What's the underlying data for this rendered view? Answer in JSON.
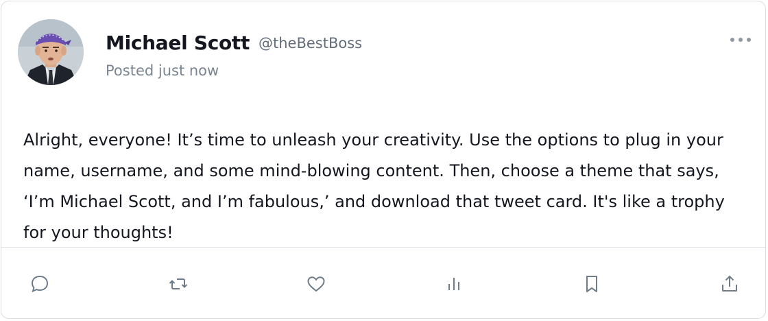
{
  "post": {
    "author": {
      "name": "Michael Scott",
      "handle": "@theBestBoss",
      "posted": "Posted just now",
      "avatar_alt": "Michael Scott avatar"
    },
    "content": "Alright, everyone! It’s time to unleash your creativity. Use the options to plug in your name, username, and some mind-blowing content. Then, choose a theme that says, ‘I’m Michael Scott, and I’m fabulous,’ and download that tweet card. It's like a trophy for your thoughts!",
    "more_icon": "more-horizontal-icon",
    "actions": [
      {
        "icon": "comment-icon",
        "label": "Reply"
      },
      {
        "icon": "retweet-icon",
        "label": "Repost"
      },
      {
        "icon": "heart-icon",
        "label": "Like"
      },
      {
        "icon": "analytics-icon",
        "label": "Views"
      },
      {
        "icon": "bookmark-icon",
        "label": "Bookmark"
      },
      {
        "icon": "share-icon",
        "label": "Share"
      }
    ]
  },
  "colors": {
    "text_primary": "#14171f",
    "text_secondary": "#626d79",
    "icon": "#6e7b88",
    "border": "#d9dde2",
    "bandana": "#6a4fb3"
  }
}
